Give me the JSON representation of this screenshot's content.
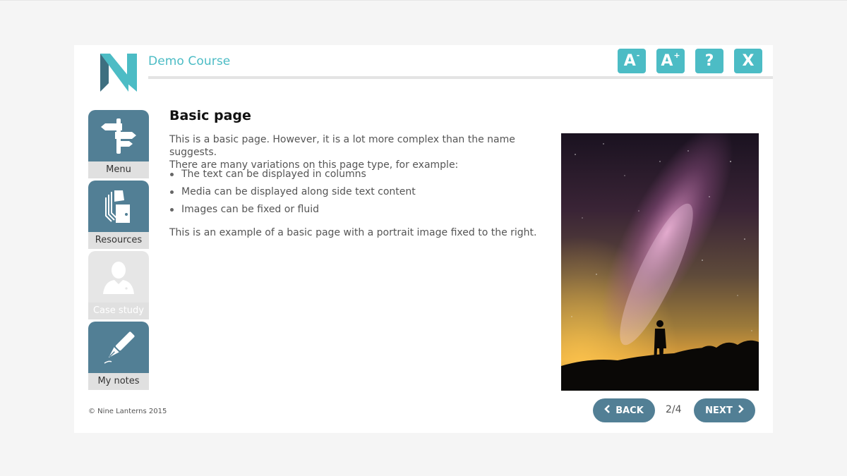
{
  "header": {
    "course_title": "Demo Course",
    "buttons": [
      {
        "name": "decrease-font",
        "label": "A",
        "sup": "-"
      },
      {
        "name": "increase-font",
        "label": "A",
        "sup": "+"
      },
      {
        "name": "help",
        "label": "?",
        "sup": ""
      },
      {
        "name": "close",
        "label": "X",
        "sup": ""
      }
    ]
  },
  "sidebar": {
    "items": [
      {
        "label": "Menu",
        "icon": "signpost-icon",
        "enabled": true
      },
      {
        "label": "Resources",
        "icon": "documents-icon",
        "enabled": true
      },
      {
        "label": "Case study",
        "icon": "person-icon",
        "enabled": false
      },
      {
        "label": "My notes",
        "icon": "pen-icon",
        "enabled": true
      }
    ]
  },
  "content": {
    "title": "Basic page",
    "intro_line1": "This is a basic page. However, it is a lot more complex than the name suggests.",
    "intro_line2": "There are many variations on this page type, for example:",
    "bullets": [
      "The text can be displayed in columns",
      "Media can be displayed along side text content",
      "Images can be fixed or fluid"
    ],
    "outro": "This is an example of a basic page with a portrait image fixed to the right."
  },
  "footer": {
    "copyright": "© Nine Lanterns 2015",
    "back_label": "BACK",
    "next_label": "NEXT",
    "page_counter": "2/4"
  },
  "colors": {
    "accent": "#4cbcc5",
    "nav": "#527f95"
  }
}
